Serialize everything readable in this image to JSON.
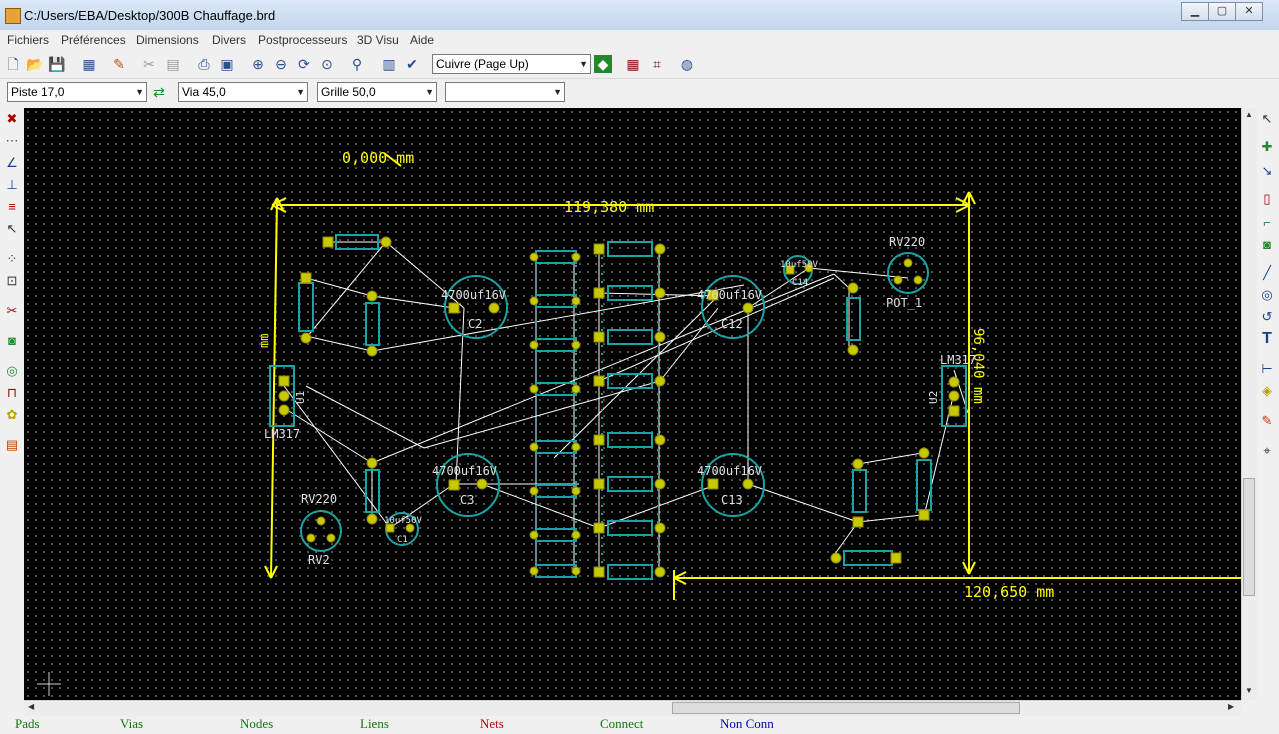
{
  "window": {
    "title": "C:/Users/EBA/Desktop/300B Chauffage.brd",
    "min": "▁",
    "max": "▢",
    "close": "✕"
  },
  "menu": [
    "Fichiers",
    "Préférences",
    "Dimensions",
    "Divers",
    "Postprocesseurs",
    "3D Visu",
    "Aide"
  ],
  "toolbar": {
    "layer_select": "Cuivre (Page Up)"
  },
  "toolbar2": {
    "track": "Piste 17,0",
    "via": "Via 45,0",
    "grid": "Grille 50,0",
    "zoom": ""
  },
  "board": {
    "dim_top": "119,380 mm",
    "dim_bottom": "120,650 mm",
    "dim_right": "96,040 mm",
    "dim_left_small": "mm",
    "coord": "0,000 mm",
    "labels": {
      "rv220_a": "RV220",
      "pot1": "POT_1",
      "lm317_r": "LM317",
      "u2": "U2",
      "u1": "U1",
      "lm317_l": "LM317",
      "rv220_b": "RV220",
      "rv2": "RV2",
      "c2": "C2",
      "c2_val": "4700uf16V",
      "c12": "C12",
      "c12_val": "4700uf16V",
      "c3": "C3",
      "c3_val": "4700uf16V",
      "c13": "C13",
      "c13_val": "4700uf16V",
      "c14_val": "10uf50V",
      "c14": "C14",
      "c1_val": "10uf50V",
      "c1": "C1"
    }
  },
  "status": {
    "pads": "Pads",
    "vias": "Vias",
    "nodes": "Nodes",
    "liens": "Liens",
    "nets": "Nets",
    "connect": "Connect",
    "nonconn": "Non Conn"
  },
  "colors": {
    "dimension": "#ffff00",
    "copper": "#1aa3a3",
    "pad": "#c8c800",
    "ratsnest": "#ffffff"
  }
}
